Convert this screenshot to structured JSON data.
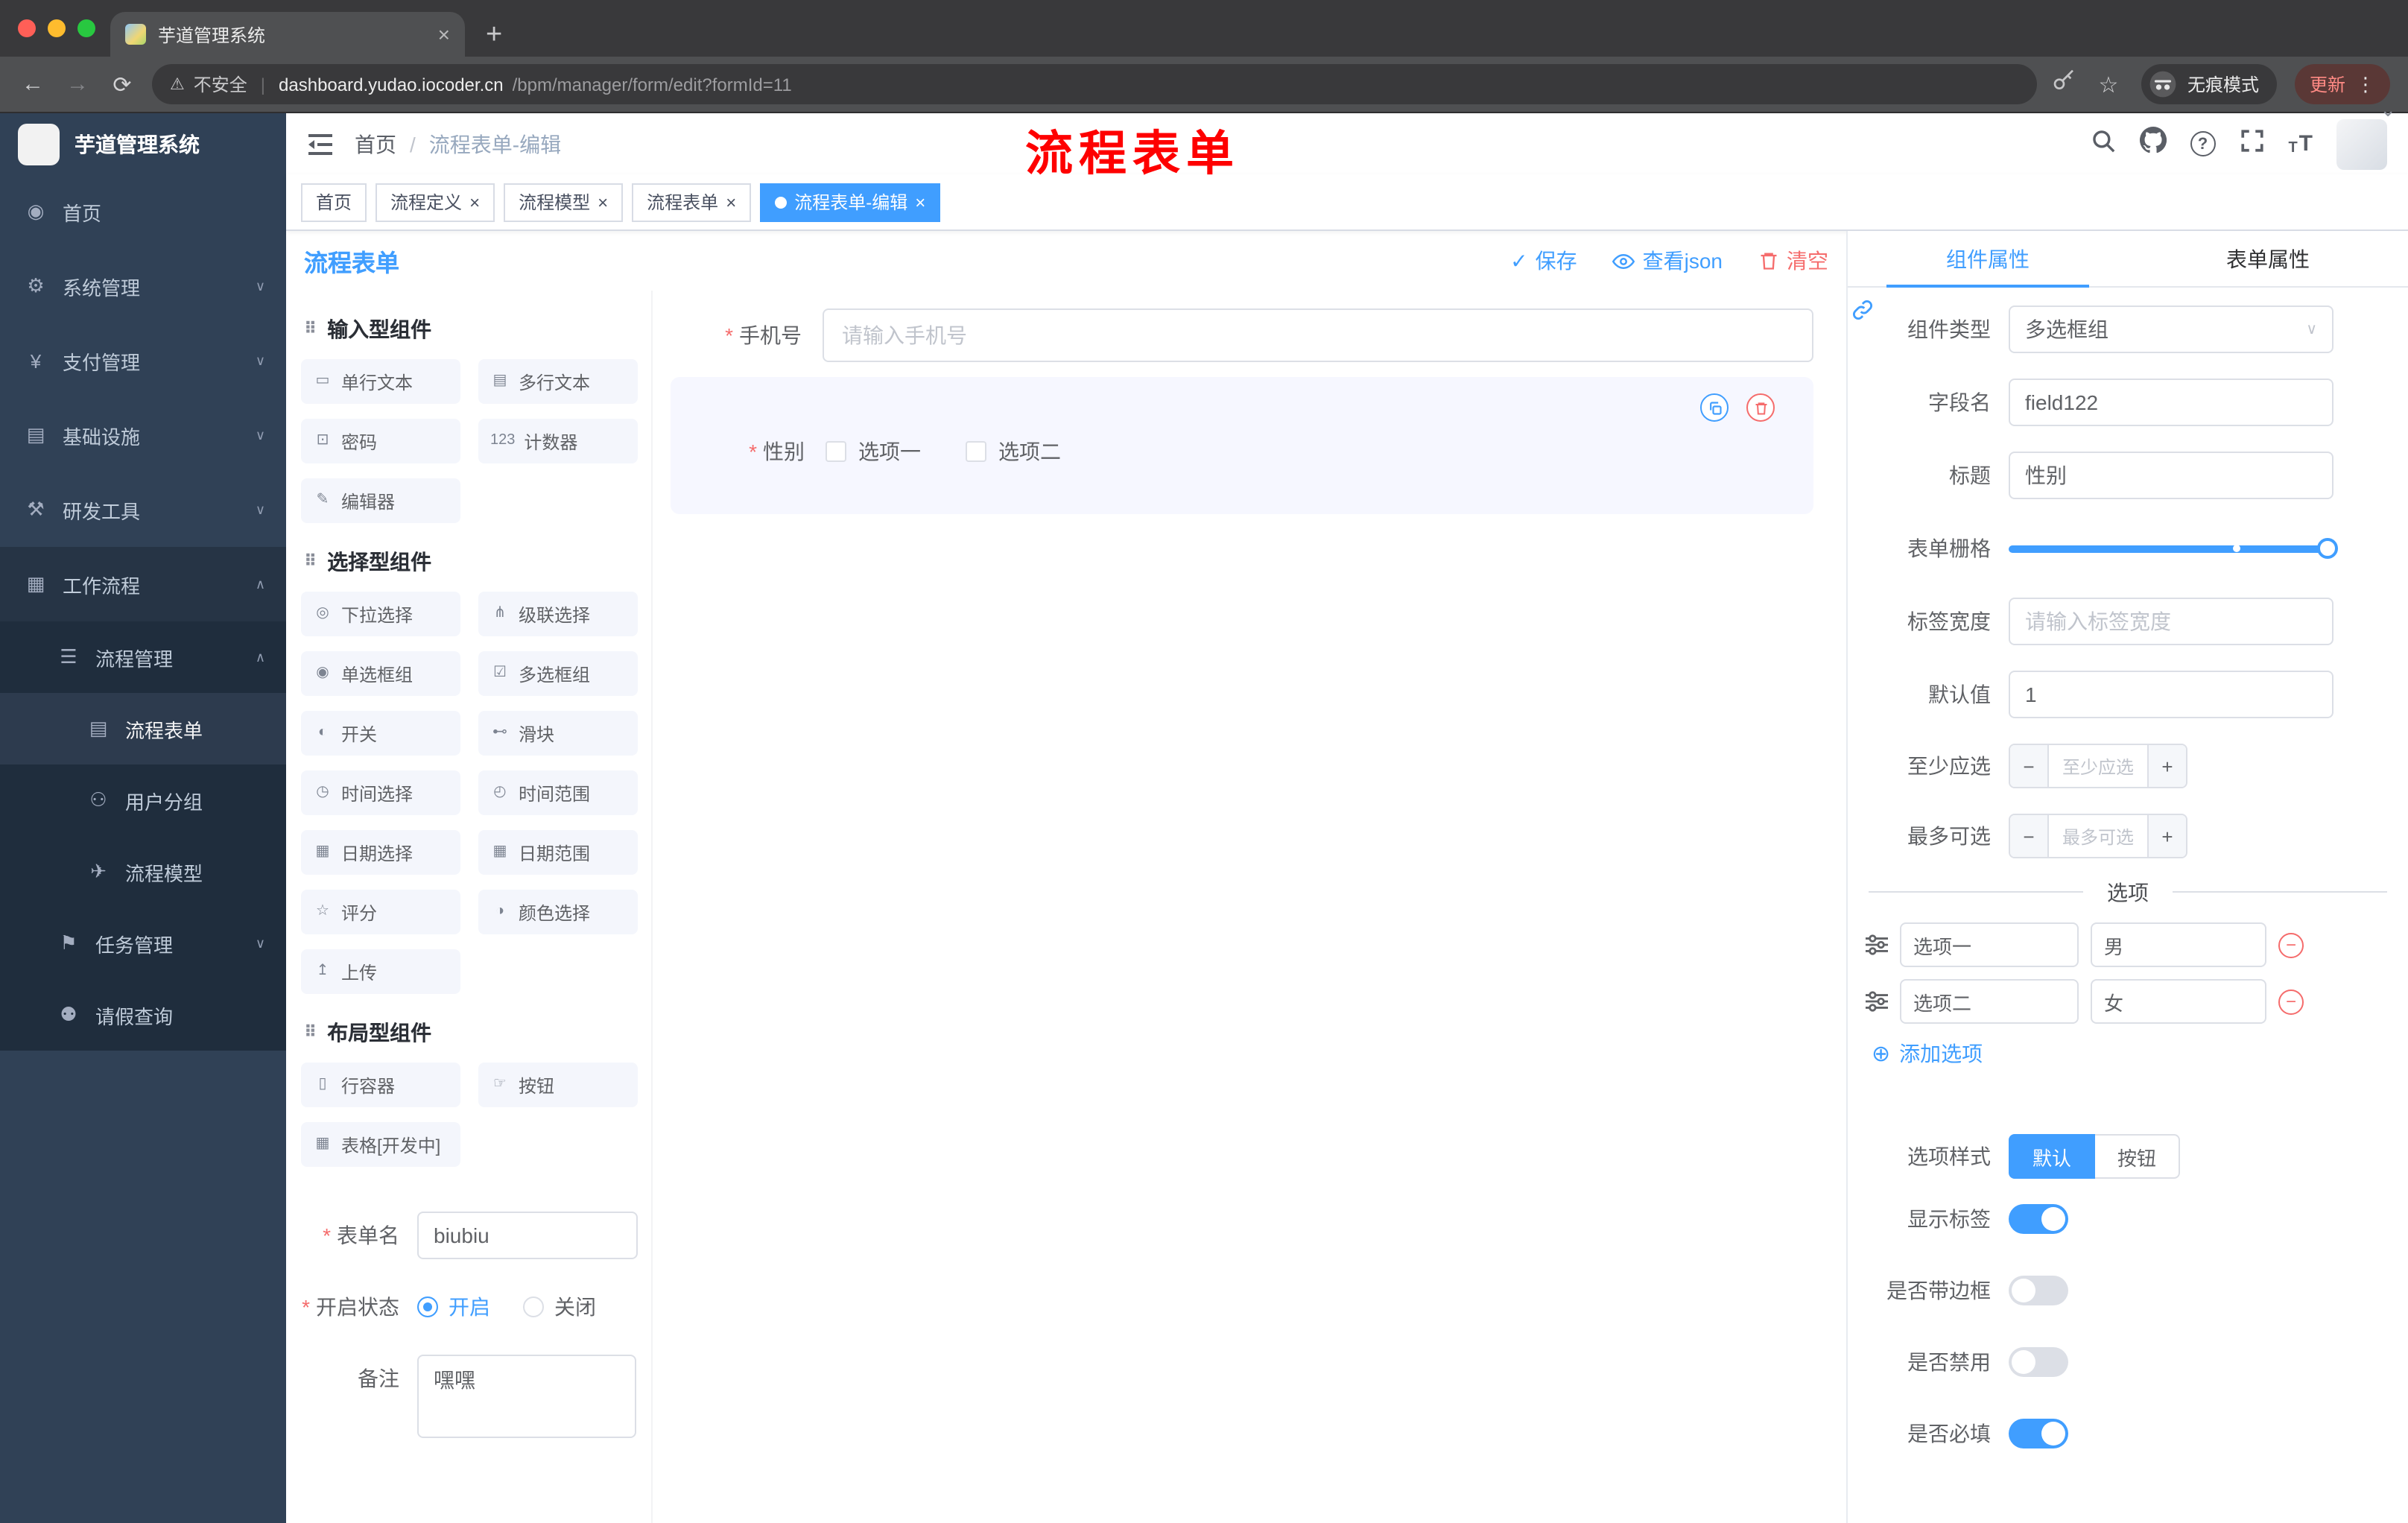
{
  "colors": {
    "accent": "#409eff",
    "danger": "#f56c6c",
    "annotation_red": "#fe0000",
    "sidebar_bg": "#304156"
  },
  "icons": {
    "close": "×",
    "plus": "+",
    "minus": "−",
    "back-arrow": "←",
    "forward-arrow": "→",
    "reload": "⟳",
    "warning": "⚠",
    "pipe": "|",
    "star": "☆",
    "dots-vertical": "⋮",
    "chevron-down": "∨",
    "chevron-up": "∧",
    "caret-down": "⌄",
    "check": "✓",
    "question": "?",
    "font-size": "T",
    "add-circle": "⊕",
    "grip": "⠿",
    "menu-dashboard": "◉",
    "menu-system": "⚙",
    "menu-payment": "¥",
    "menu-infra": "▤",
    "menu-devtools": "⚒",
    "menu-workflow": "▦",
    "menu-process": "☰",
    "menu-form": "▤",
    "menu-user-group": "⚇",
    "menu-model": "✈",
    "menu-task": "⚑",
    "menu-leave": "⚉",
    "comp-input": "▭",
    "comp-textarea": "▤",
    "comp-password": "⊡",
    "comp-counter": "123",
    "comp-editor": "✎",
    "comp-select": "◎",
    "comp-cascader": "⋔",
    "comp-radio": "◉",
    "comp-checkbox": "☑",
    "comp-switch": "◐",
    "comp-slider": "⊷",
    "comp-time": "◷",
    "comp-time-range": "◴",
    "comp-date": "▦",
    "comp-date-range": "▦",
    "comp-rate": "☆",
    "comp-color": "◑",
    "comp-upload": "↥",
    "comp-row": "▯",
    "comp-button": "☞",
    "comp-table": "▦"
  },
  "browser": {
    "tab_title": "芋道管理系统",
    "security_label": "不安全",
    "url_host": "dashboard.yudao.iocoder.cn",
    "url_path": "/bpm/manager/form/edit?formId=11",
    "incognito_label": "无痕模式",
    "update_label": "更新"
  },
  "annotation": {
    "text": "流程表单"
  },
  "sidebar": {
    "title": "芋道管理系统",
    "items": [
      {
        "label": "首页"
      },
      {
        "label": "系统管理"
      },
      {
        "label": "支付管理"
      },
      {
        "label": "基础设施"
      },
      {
        "label": "研发工具"
      },
      {
        "label": "工作流程"
      }
    ],
    "workflow": {
      "process_management": {
        "label": "流程管理",
        "children": [
          {
            "label": "流程表单",
            "active": true
          },
          {
            "label": "用户分组"
          },
          {
            "label": "流程模型"
          }
        ]
      },
      "task_management": {
        "label": "任务管理"
      },
      "leave_query": {
        "label": "请假查询"
      }
    }
  },
  "header": {
    "breadcrumb": [
      "首页",
      "流程表单-编辑"
    ],
    "separator": "/"
  },
  "tags": [
    {
      "label": "首页",
      "closable": false,
      "active": false
    },
    {
      "label": "流程定义",
      "closable": true,
      "active": false
    },
    {
      "label": "流程模型",
      "closable": true,
      "active": false
    },
    {
      "label": "流程表单",
      "closable": true,
      "active": false
    },
    {
      "label": "流程表单-编辑",
      "closable": true,
      "active": true
    }
  ],
  "toolbar": {
    "title": "流程表单",
    "save_label": "保存",
    "view_json_label": "查看json",
    "clear_label": "清空"
  },
  "palette": {
    "sections": [
      {
        "title": "输入型组件",
        "items": [
          {
            "label": "单行文本"
          },
          {
            "label": "多行文本"
          },
          {
            "label": "密码"
          },
          {
            "label": "计数器"
          },
          {
            "label": "编辑器"
          }
        ]
      },
      {
        "title": "选择型组件",
        "items": [
          {
            "label": "下拉选择"
          },
          {
            "label": "级联选择"
          },
          {
            "label": "单选框组"
          },
          {
            "label": "多选框组"
          },
          {
            "label": "开关"
          },
          {
            "label": "滑块"
          },
          {
            "label": "时间选择"
          },
          {
            "label": "时间范围"
          },
          {
            "label": "日期选择"
          },
          {
            "label": "日期范围"
          },
          {
            "label": "评分"
          },
          {
            "label": "颜色选择"
          },
          {
            "label": "上传"
          }
        ]
      },
      {
        "title": "布局型组件",
        "items": [
          {
            "label": "行容器"
          },
          {
            "label": "按钮"
          },
          {
            "label": "表格[开发中]"
          }
        ]
      }
    ],
    "form": {
      "form_name_label": "表单名",
      "form_name_value": "biubiu",
      "status_label": "开启状态",
      "status_on": "开启",
      "status_off": "关闭",
      "status_selected": "开启",
      "remark_label": "备注",
      "remark_value": "嘿嘿"
    }
  },
  "canvas": {
    "phone": {
      "label": "手机号",
      "required": true,
      "placeholder": "请输入手机号"
    },
    "gender": {
      "label": "性别",
      "required": true,
      "option1": "选项一",
      "option2": "选项二",
      "selected": true
    }
  },
  "props": {
    "tab_component": "组件属性",
    "tab_form": "表单属性",
    "active_tab": "组件属性",
    "component_type_label": "组件类型",
    "component_type_value": "多选框组",
    "field_name_label": "字段名",
    "field_name_value": "field122",
    "title_label": "标题",
    "title_value": "性别",
    "grid_label": "表单栅格",
    "grid_value_percent": 100,
    "label_width_label": "标签宽度",
    "label_width_placeholder": "请输入标签宽度",
    "default_label": "默认值",
    "default_value": "1",
    "min_label": "至少应选",
    "min_placeholder": "至少应选",
    "max_label": "最多可选",
    "max_placeholder": "最多可选",
    "options_title": "选项",
    "options": [
      {
        "label": "选项一",
        "value": "男"
      },
      {
        "label": "选项二",
        "value": "女"
      }
    ],
    "add_option_label": "添加选项",
    "option_style_label": "选项样式",
    "option_style_default": "默认",
    "option_style_button": "按钮",
    "option_style_selected": "默认",
    "show_label_label": "显示标签",
    "show_label_value": true,
    "border_label": "是否带边框",
    "border_value": false,
    "disabled_label": "是否禁用",
    "disabled_value": false,
    "required_label": "是否必填",
    "required_value": true
  }
}
